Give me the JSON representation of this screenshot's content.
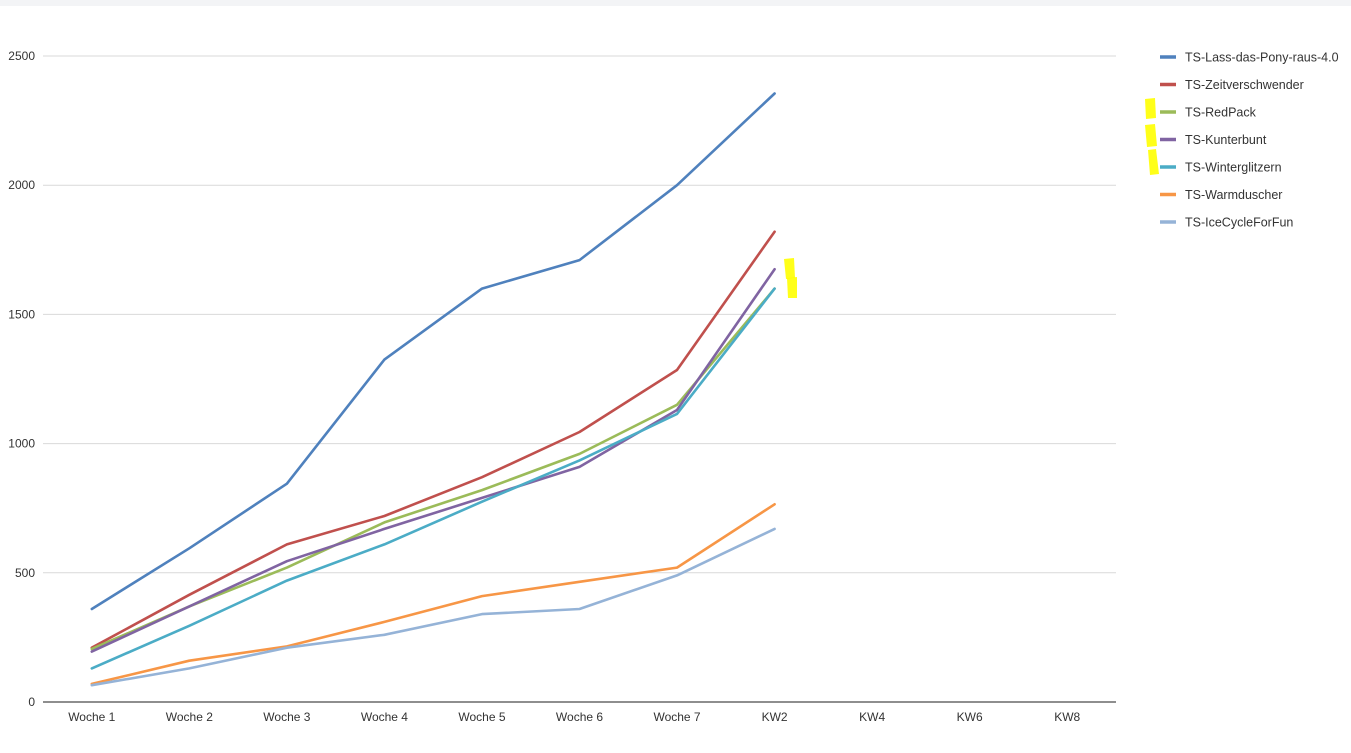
{
  "chart_data": {
    "type": "line",
    "title": "",
    "xlabel": "",
    "ylabel": "",
    "categories": [
      "Woche 1",
      "Woche 2",
      "Woche 3",
      "Woche 4",
      "Woche 5",
      "Woche 6",
      "Woche 7",
      "KW2",
      "KW4",
      "KW6",
      "KW8"
    ],
    "y_ticks": [
      0,
      500,
      1000,
      1500,
      2000,
      2500
    ],
    "ylim": [
      0,
      2500
    ],
    "grid": true,
    "legend_position": "right",
    "series": [
      {
        "name": "TS-Lass-das-Pony-raus-4.0",
        "color": "#4f81bd",
        "values": [
          360,
          595,
          845,
          1325,
          1600,
          1710,
          2000,
          2355
        ]
      },
      {
        "name": "TS-Zeitverschwender",
        "color": "#c0504d",
        "values": [
          210,
          415,
          610,
          720,
          870,
          1045,
          1285,
          1820
        ]
      },
      {
        "name": "TS-RedPack",
        "color": "#9bbb59",
        "values": [
          205,
          370,
          520,
          695,
          820,
          960,
          1150,
          1600
        ]
      },
      {
        "name": "TS-Kunterbunt",
        "color": "#8064a2",
        "values": [
          195,
          370,
          545,
          670,
          790,
          910,
          1130,
          1675
        ]
      },
      {
        "name": "TS-Winterglitzern",
        "color": "#4bacc6",
        "values": [
          130,
          295,
          470,
          610,
          775,
          935,
          1115,
          1600
        ]
      },
      {
        "name": "TS-Warmduscher",
        "color": "#f79646",
        "values": [
          70,
          160,
          215,
          310,
          410,
          465,
          520,
          765
        ]
      },
      {
        "name": "TS-IceCycleForFun",
        "color": "#95b3d7",
        "values": [
          65,
          130,
          210,
          260,
          340,
          360,
          490,
          670
        ]
      }
    ],
    "highlight_color": "#ffff00"
  }
}
